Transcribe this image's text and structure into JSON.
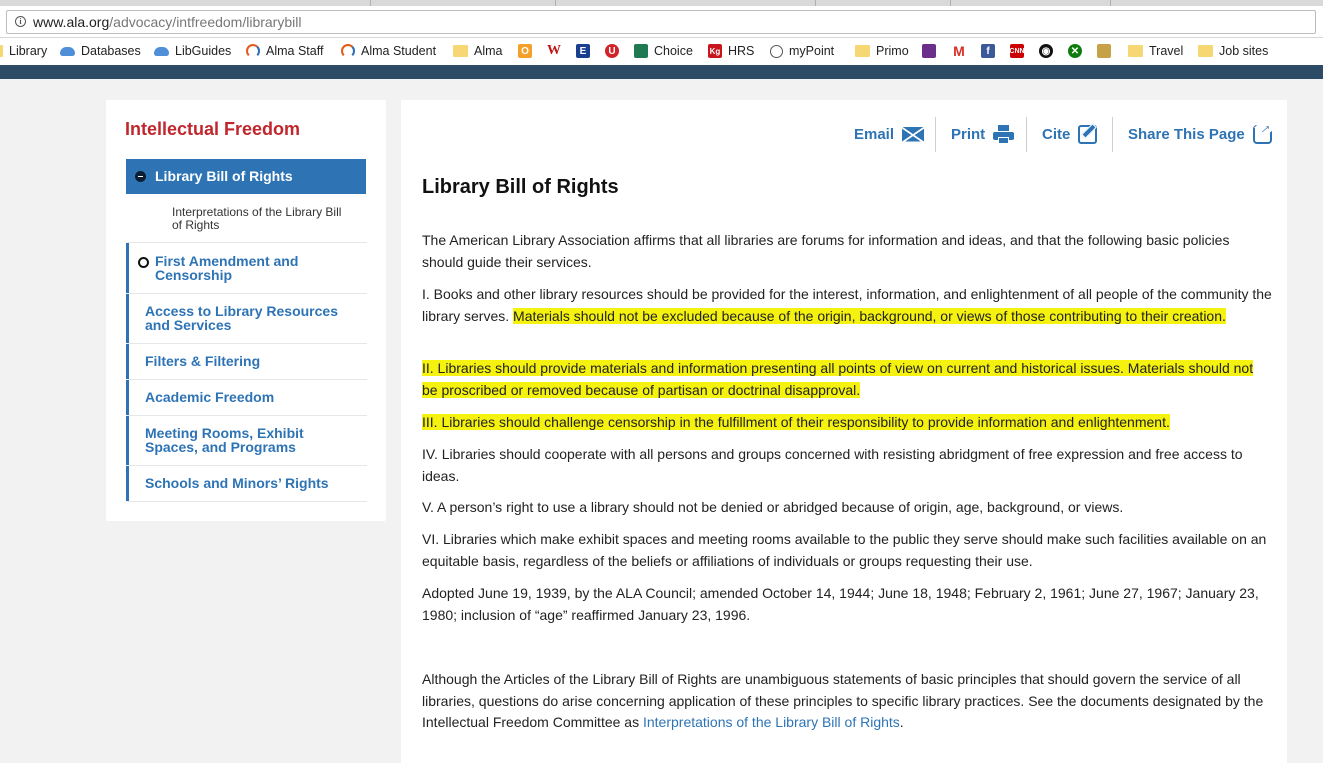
{
  "browser": {
    "url_host": "www.ala.org",
    "url_path": "/advocacy/intfreedom/librarybill"
  },
  "bookmarks": [
    {
      "label": "Library",
      "icon": "folder-icon"
    },
    {
      "label": "Databases",
      "icon": "cloud-icon"
    },
    {
      "label": "LibGuides",
      "icon": "cloud-icon"
    },
    {
      "label": "Alma Staff",
      "icon": "alma-icon"
    },
    {
      "label": "Alma Student",
      "icon": "alma-icon"
    },
    {
      "label": "Alma",
      "icon": "folder-icon"
    },
    {
      "label": "",
      "icon": "rss-icon"
    },
    {
      "label": "",
      "icon": "wikipedia-icon"
    },
    {
      "label": "",
      "icon": "e-icon"
    },
    {
      "label": "",
      "icon": "red-circle-icon"
    },
    {
      "label": "Choice",
      "icon": "choice-icon"
    },
    {
      "label": "HRS",
      "icon": "kg-icon"
    },
    {
      "label": "myPoint",
      "icon": "mypoint-icon"
    },
    {
      "label": "Primo",
      "icon": "folder-icon"
    },
    {
      "label": "",
      "icon": "mail-icon"
    },
    {
      "label": "",
      "icon": "gmail-icon"
    },
    {
      "label": "",
      "icon": "facebook-icon"
    },
    {
      "label": "",
      "icon": "cnn-icon"
    },
    {
      "label": "",
      "icon": "eye-icon"
    },
    {
      "label": "",
      "icon": "xbox-icon"
    },
    {
      "label": "",
      "icon": "owl-icon"
    },
    {
      "label": "Travel",
      "icon": "folder-icon"
    },
    {
      "label": "Job sites",
      "icon": "folder-icon"
    }
  ],
  "sidebar": {
    "title": "Intellectual Freedom",
    "active_item": "Library Bill of Rights",
    "sub_item": "Interpretations of the Library Bill of Rights",
    "items": [
      "First Amendment and Censorship",
      "Access to Library Resources and Services",
      "Filters & Filtering",
      "Academic Freedom",
      "Meeting Rooms, Exhibit Spaces, and Programs",
      "Schools and Minors’ Rights"
    ]
  },
  "toolbar": {
    "email": "Email",
    "print": "Print",
    "cite": "Cite",
    "share": "Share This Page"
  },
  "article": {
    "title": "Library Bill of Rights",
    "intro": "The American Library Association affirms that all libraries are forums for information and ideas, and that the following basic policies should guide their services.",
    "p1_plain": "I. Books and other library resources should be provided for the interest, information, and enlightenment of all people of the community the library serves. ",
    "p1_highlight": "Materials should not be excluded because of the origin, background, or views of those contributing to their creation.",
    "p2": "II. Libraries should provide materials and information presenting all points of view on current and historical issues. Materials should not be proscribed or removed because of partisan or doctrinal disapproval.",
    "p3": "III. Libraries should challenge censorship in the fulfillment of their responsibility to provide information and enlightenment.",
    "p4": "IV. Libraries should cooperate with all persons and groups concerned with resisting abridgment of free expression and free access to ideas.",
    "p5": "V. A person’s right to use a library should not be denied or abridged because of origin, age, background, or views.",
    "p6": "VI. Libraries which make exhibit spaces and meeting rooms available to the public they serve should make such facilities available on an equitable basis, regardless of the beliefs or affiliations of individuals or groups requesting their use.",
    "adopted": "Adopted June 19, 1939, by the ALA Council; amended October 14, 1944; June 18, 1948; February 2, 1961; June 27, 1967; January 23, 1980; inclusion of “age” reaffirmed January 23, 1996.",
    "closing_before": "Although the Articles of the Library Bill of Rights are unambiguous statements of basic principles that should govern the service of all libraries, questions do arise concerning application of these principles to specific library practices. See the documents designated by the Intellectual Freedom Committee as ",
    "closing_link": "Interpretations of the Library Bill of Rights",
    "closing_after": "."
  },
  "colors": {
    "accent": "#2e74b5",
    "sidebar_title": "#c0272d",
    "highlight": "#f5f20f",
    "site_bar": "#2d4a66"
  }
}
